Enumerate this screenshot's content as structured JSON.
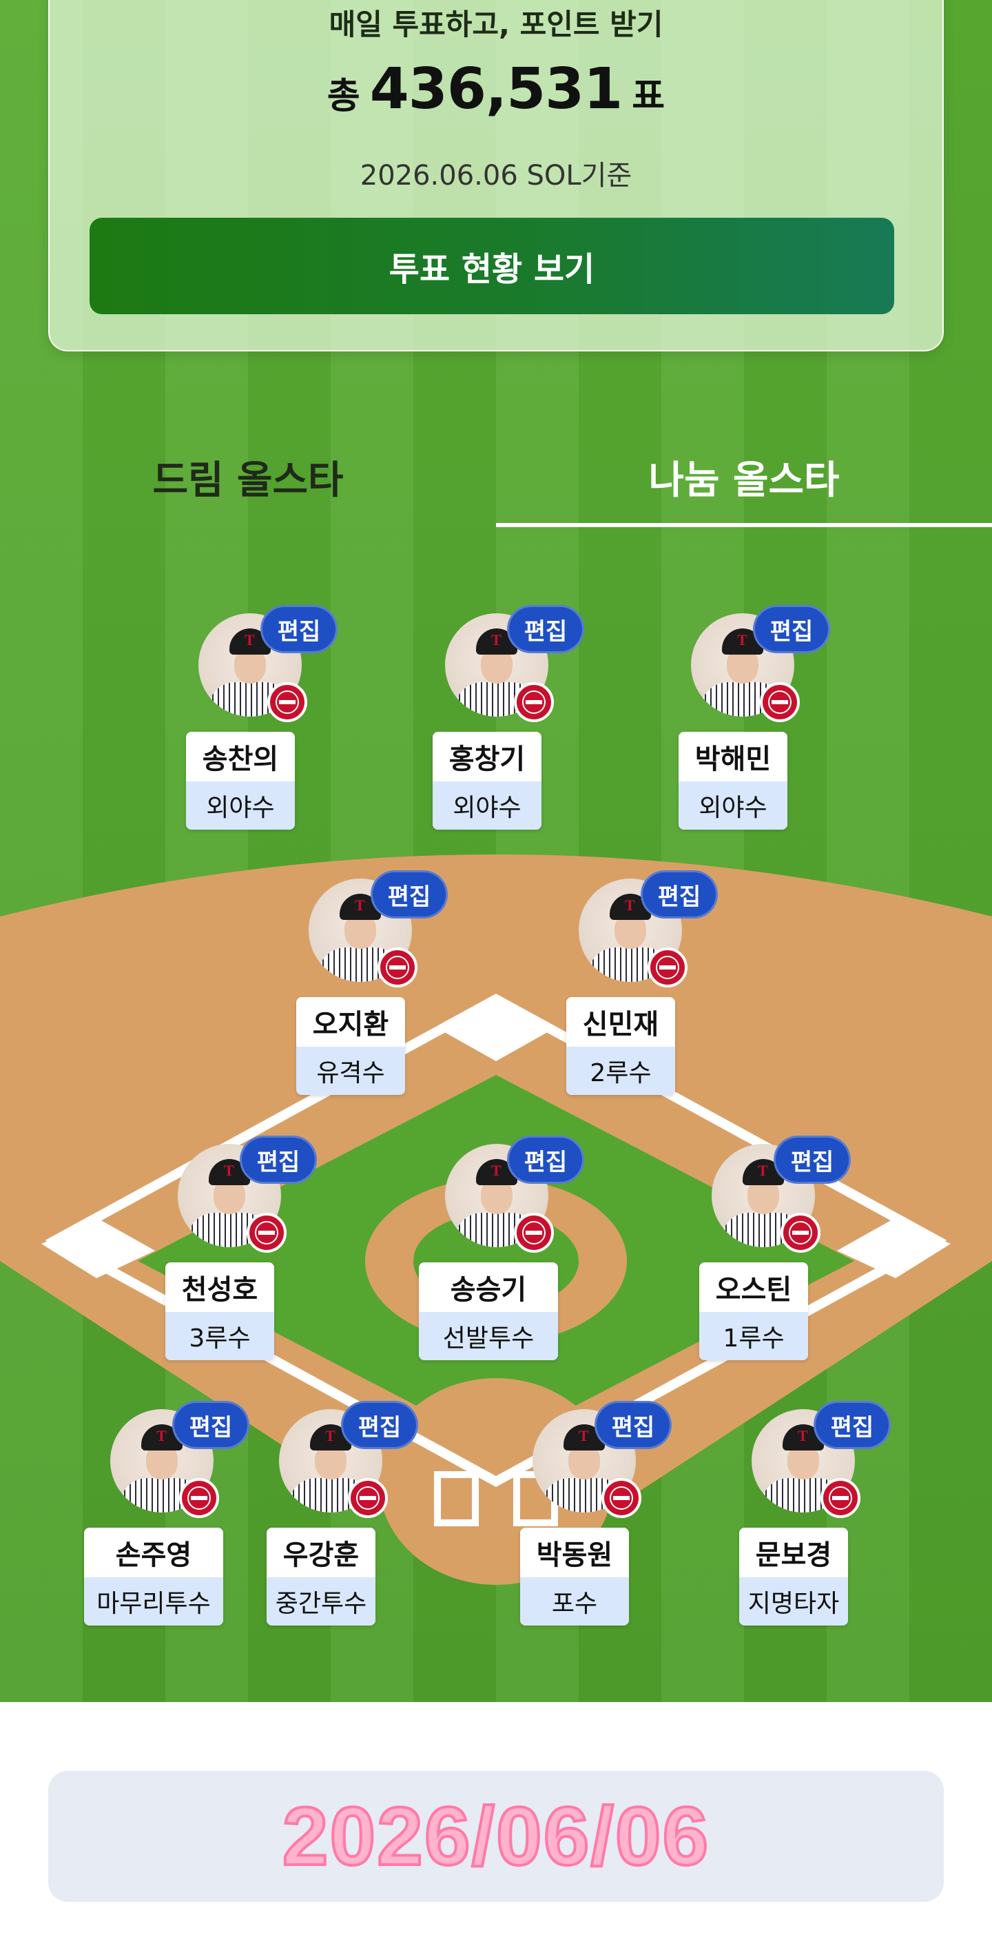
{
  "vote_summary": {
    "headline": "매일 투표하고, 포인트 받기",
    "total_prefix": "총",
    "total_votes": "436,531",
    "total_suffix": "표",
    "date_basis": "2026.06.06 SOL기준",
    "button_label": "투표 현황 보기"
  },
  "tabs": [
    {
      "label": "드림 올스타",
      "selected": false
    },
    {
      "label": "나눔 올스타",
      "selected": true
    }
  ],
  "edit_label": "편집",
  "team_logo_name": "TWINS",
  "players": [
    {
      "name": "송찬의",
      "position": "외야수"
    },
    {
      "name": "홍창기",
      "position": "외야수"
    },
    {
      "name": "박해민",
      "position": "외야수"
    },
    {
      "name": "오지환",
      "position": "유격수"
    },
    {
      "name": "신민재",
      "position": "2루수"
    },
    {
      "name": "천성호",
      "position": "3루수"
    },
    {
      "name": "송승기",
      "position": "선발투수"
    },
    {
      "name": "오스틴",
      "position": "1루수"
    },
    {
      "name": "손주영",
      "position": "마무리투수"
    },
    {
      "name": "우강훈",
      "position": "중간투수"
    },
    {
      "name": "박동원",
      "position": "포수"
    },
    {
      "name": "문보경",
      "position": "지명타자"
    }
  ],
  "bottom_date": "2026/06/06",
  "colors": {
    "grass": "#55a630",
    "infield_dirt": "#d9a066",
    "button_green": "#1d7a12",
    "edit_badge_blue": "#1f4fc4",
    "position_bg": "#d8e7fb",
    "team_red": "#c8102e",
    "date_pink": "#ffb3cc"
  }
}
